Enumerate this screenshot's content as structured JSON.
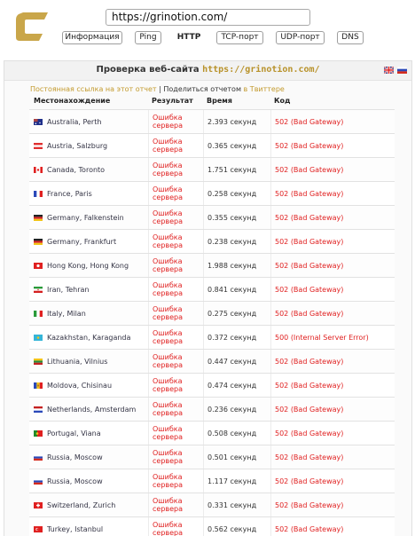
{
  "header": {
    "url_value": "https://grinotion.com/",
    "tabs": [
      {
        "label": "Информация",
        "active": false
      },
      {
        "label": "Ping",
        "active": false
      },
      {
        "label": "HTTP",
        "active": true
      },
      {
        "label": "TCP-порт",
        "active": false
      },
      {
        "label": "UDP-порт",
        "active": false
      },
      {
        "label": "DNS",
        "active": false
      }
    ]
  },
  "panel": {
    "title_prefix": "Проверка веб-сайта",
    "title_site": "https://grinotion.com/",
    "permalink": "Постоянная ссылка на этот отчет",
    "separator": "|",
    "share_prefix": "Поделиться отчетом",
    "share_link": "в Твиттере",
    "lang_icons": [
      "uk-flag-icon",
      "ru-flag-icon"
    ]
  },
  "table": {
    "headers": {
      "location": "Местонахождение",
      "result": "Результат",
      "time": "Время",
      "code": "Код"
    },
    "rows": [
      {
        "location": "Australia, Perth",
        "flag": "australia-flag-icon",
        "result": "Ошибка сервера",
        "time": "2.393 секунд",
        "code": "502 (Bad Gateway)"
      },
      {
        "location": "Austria, Salzburg",
        "flag": "austria-flag-icon",
        "result": "Ошибка сервера",
        "time": "0.365 секунд",
        "code": "502 (Bad Gateway)"
      },
      {
        "location": "Canada, Toronto",
        "flag": "canada-flag-icon",
        "result": "Ошибка сервера",
        "time": "1.751 секунд",
        "code": "502 (Bad Gateway)"
      },
      {
        "location": "France, Paris",
        "flag": "france-flag-icon",
        "result": "Ошибка сервера",
        "time": "0.258 секунд",
        "code": "502 (Bad Gateway)"
      },
      {
        "location": "Germany, Falkenstein",
        "flag": "germany-flag-icon",
        "result": "Ошибка сервера",
        "time": "0.355 секунд",
        "code": "502 (Bad Gateway)"
      },
      {
        "location": "Germany, Frankfurt",
        "flag": "germany-flag-icon",
        "result": "Ошибка сервера",
        "time": "0.238 секунд",
        "code": "502 (Bad Gateway)"
      },
      {
        "location": "Hong Kong, Hong Kong",
        "flag": "hongkong-flag-icon",
        "result": "Ошибка сервера",
        "time": "1.988 секунд",
        "code": "502 (Bad Gateway)"
      },
      {
        "location": "Iran, Tehran",
        "flag": "iran-flag-icon",
        "result": "Ошибка сервера",
        "time": "0.841 секунд",
        "code": "502 (Bad Gateway)"
      },
      {
        "location": "Italy, Milan",
        "flag": "italy-flag-icon",
        "result": "Ошибка сервера",
        "time": "0.275 секунд",
        "code": "502 (Bad Gateway)"
      },
      {
        "location": "Kazakhstan, Karaganda",
        "flag": "kazakhstan-flag-icon",
        "result": "Ошибка сервера",
        "time": "0.372 секунд",
        "code": "500 (Internal Server Error)"
      },
      {
        "location": "Lithuania, Vilnius",
        "flag": "lithuania-flag-icon",
        "result": "Ошибка сервера",
        "time": "0.447 секунд",
        "code": "502 (Bad Gateway)"
      },
      {
        "location": "Moldova, Chisinau",
        "flag": "moldova-flag-icon",
        "result": "Ошибка сервера",
        "time": "0.474 секунд",
        "code": "502 (Bad Gateway)"
      },
      {
        "location": "Netherlands, Amsterdam",
        "flag": "netherlands-flag-icon",
        "result": "Ошибка сервера",
        "time": "0.236 секунд",
        "code": "502 (Bad Gateway)"
      },
      {
        "location": "Portugal, Viana",
        "flag": "portugal-flag-icon",
        "result": "Ошибка сервера",
        "time": "0.508 секунд",
        "code": "502 (Bad Gateway)"
      },
      {
        "location": "Russia, Moscow",
        "flag": "russia-flag-icon",
        "result": "Ошибка сервера",
        "time": "0.501 секунд",
        "code": "502 (Bad Gateway)"
      },
      {
        "location": "Russia, Moscow",
        "flag": "russia-flag-icon",
        "result": "Ошибка сервера",
        "time": "1.117 секунд",
        "code": "502 (Bad Gateway)"
      },
      {
        "location": "Switzerland, Zurich",
        "flag": "switzerland-flag-icon",
        "result": "Ошибка сервера",
        "time": "0.331 секунд",
        "code": "502 (Bad Gateway)"
      },
      {
        "location": "Turkey, Istanbul",
        "flag": "turkey-flag-icon",
        "result": "Ошибка сервера",
        "time": "0.562 секунд",
        "code": "502 (Bad Gateway)"
      }
    ]
  },
  "colors": {
    "accent": "#c39a2d",
    "error": "#e02020",
    "logo": "#c9a64a"
  }
}
